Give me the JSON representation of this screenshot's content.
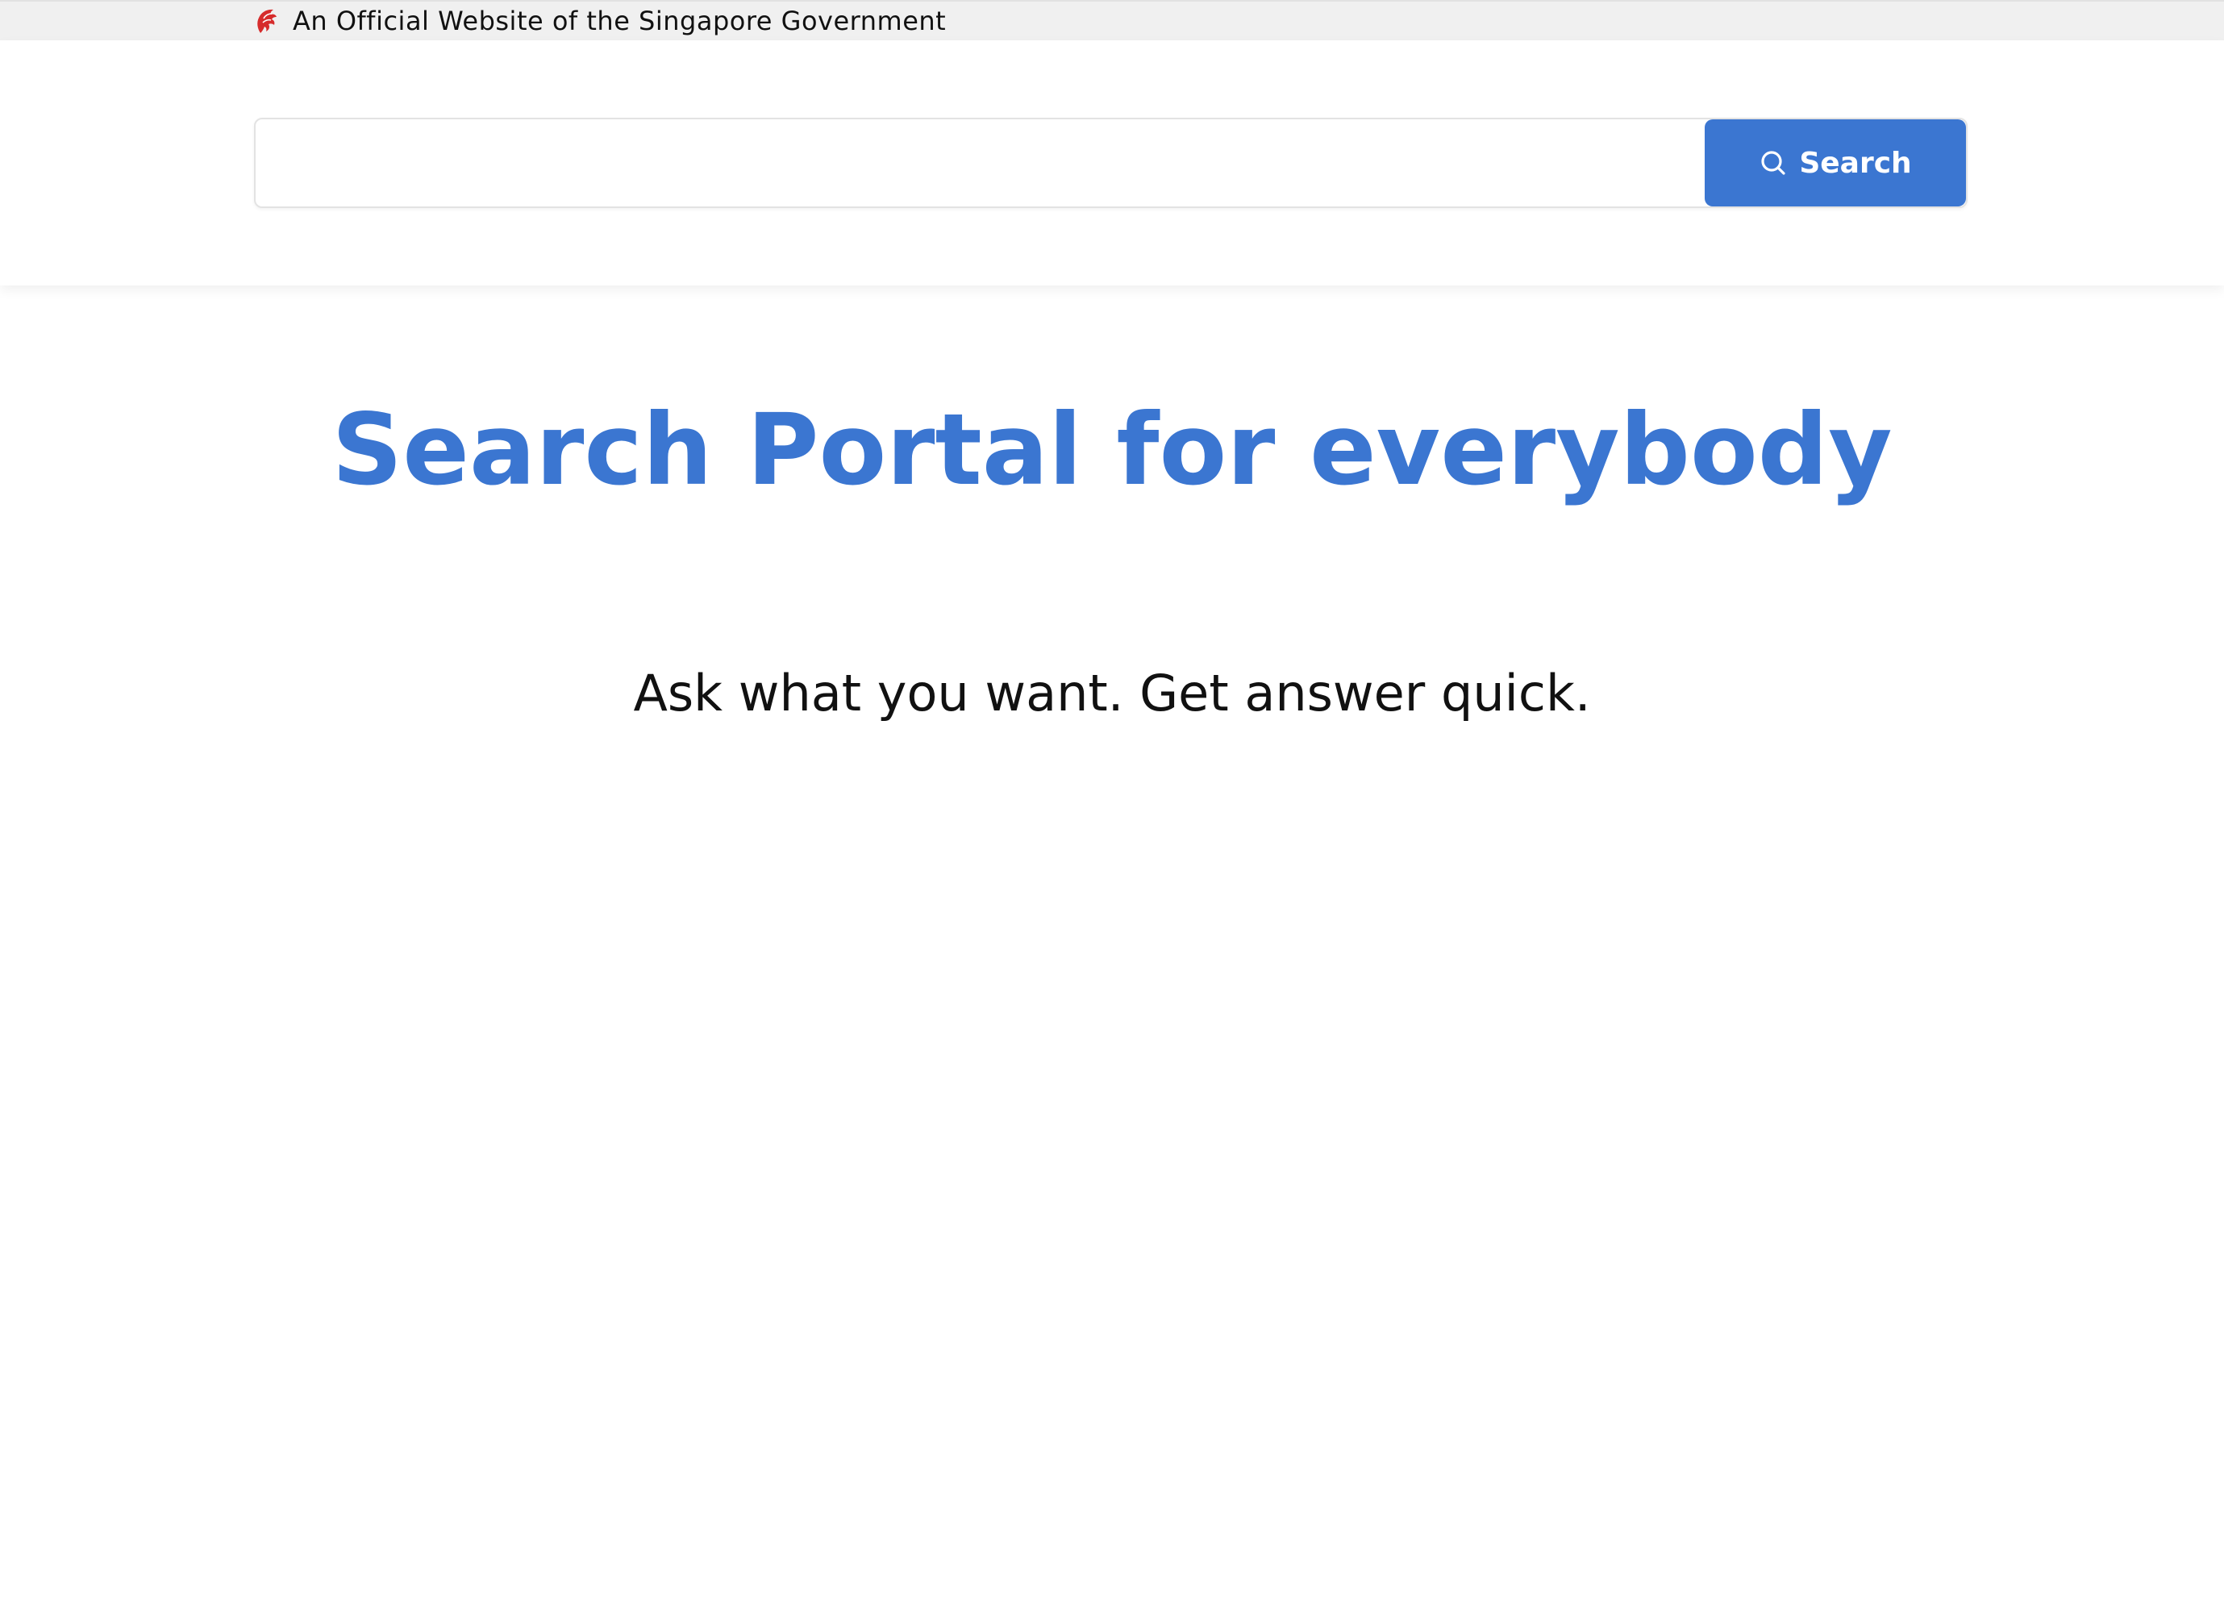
{
  "masthead": {
    "text": "An Official Website of the Singapore Government",
    "icon": "singapore-lion-head-icon",
    "icon_color": "#d62c2c"
  },
  "search": {
    "placeholder": "",
    "value": "",
    "button_label": "Search",
    "button_icon": "search-icon"
  },
  "hero": {
    "title": "Search Portal for everybody",
    "subtitle": "Ask what you want. Get answer quick."
  },
  "colors": {
    "accent": "#3b76d1",
    "masthead_bg": "#f0f0f0",
    "text": "#111111"
  }
}
